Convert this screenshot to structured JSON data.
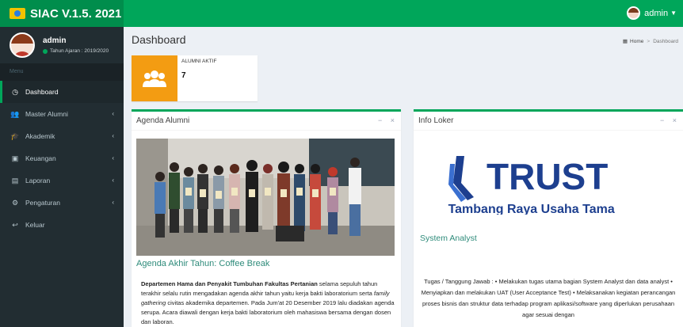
{
  "app": {
    "title": "SIAC V.1.5. 2021"
  },
  "topbar": {
    "user_label": "admin"
  },
  "sidebar": {
    "user_name": "admin",
    "user_status": "Tahun Ajaran : 2019/2020",
    "menu_header": "Menu",
    "items": [
      {
        "label": "Dashboard",
        "icon": "dashboard-icon",
        "active": true
      },
      {
        "label": "Master Alumni",
        "icon": "users-icon",
        "has_arrow": true
      },
      {
        "label": "Akademik",
        "icon": "graduation-cap-icon",
        "has_arrow": true
      },
      {
        "label": "Keuangan",
        "icon": "money-icon",
        "has_arrow": true
      },
      {
        "label": "Laporan",
        "icon": "report-icon",
        "has_arrow": true
      },
      {
        "label": "Pengaturan",
        "icon": "gear-icon",
        "has_arrow": true
      },
      {
        "label": "Keluar",
        "icon": "logout-icon"
      }
    ]
  },
  "content": {
    "title": "Dashboard",
    "breadcrumb": {
      "home": "Home",
      "current": "Dashboard"
    }
  },
  "stat": {
    "label": "ALUMNI AKTIF",
    "value": "7"
  },
  "agenda": {
    "box_title": "Agenda Alumni",
    "post_title": "Agenda Akhir Tahun: Coffee Break",
    "body_bold": "Departemen Hama dan Penyakit Tumbuhan Fakultas Pertanian",
    "body_1": " selama sepuluh tahun terakhir selalu rutin mengadakan agenda akhir tahun yaitu kerja bakti laboratorium serta ",
    "body_italic": "family gathering",
    "body_2": " civitas akademika departemen. Pada Jum'at 20 Desember 2019 lalu diadakan agenda serupa. Acara diawali dengan kerja bakti laboratorium oleh mahasiswa bersama dengan dosen dan laboran."
  },
  "loker": {
    "box_title": "Info Loker",
    "logo_text": "TRUST",
    "company": "PT. Tambang Raya Usaha Tama",
    "job_title": "System Analyst",
    "body": "Tugas / Tanggung Jawab : • Melakukan tugas utama bagian System Analyst dan data analyst • Menyiapkan dan melakukan UAT (User Acceptance Test) • Melaksanakan kegiatan perancangan proses bisnis dan struktur data terhadap program aplikasi/software yang diperlukan perusahaan agar sesuai dengan"
  },
  "colors": {
    "topbar": "#00a65a",
    "sidebar": "#222d32",
    "stat_icon": "#f39c12",
    "trust_blue": "#1d3f8f"
  }
}
